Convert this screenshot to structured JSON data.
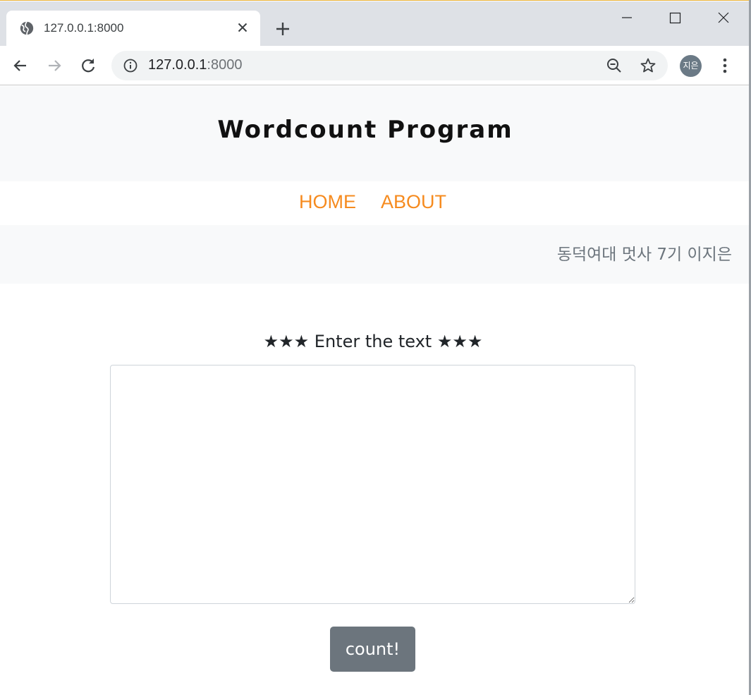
{
  "browser": {
    "tab": {
      "title": "127.0.0.1:8000",
      "favicon": "globe-icon"
    },
    "address_bar": {
      "host": "127.0.0.1",
      "port": ":8000"
    },
    "profile_initials": "지은",
    "colors": {
      "tabstrip": "#dee1e6",
      "omnibox": "#f1f3f4",
      "avatar": "#6b7a86"
    }
  },
  "site": {
    "title": "Wordcount Program",
    "nav": [
      {
        "label": "HOME"
      },
      {
        "label": "ABOUT"
      }
    ],
    "author": "동덕여대 멋사 7기 이지은",
    "colors": {
      "nav_link": "#f68b1f",
      "header_bg": "#f8f9fa",
      "button_bg": "#6c757d"
    }
  },
  "form": {
    "prompt": "★★★ Enter the text ★★★",
    "textarea_value": "",
    "submit_label": "count!"
  }
}
